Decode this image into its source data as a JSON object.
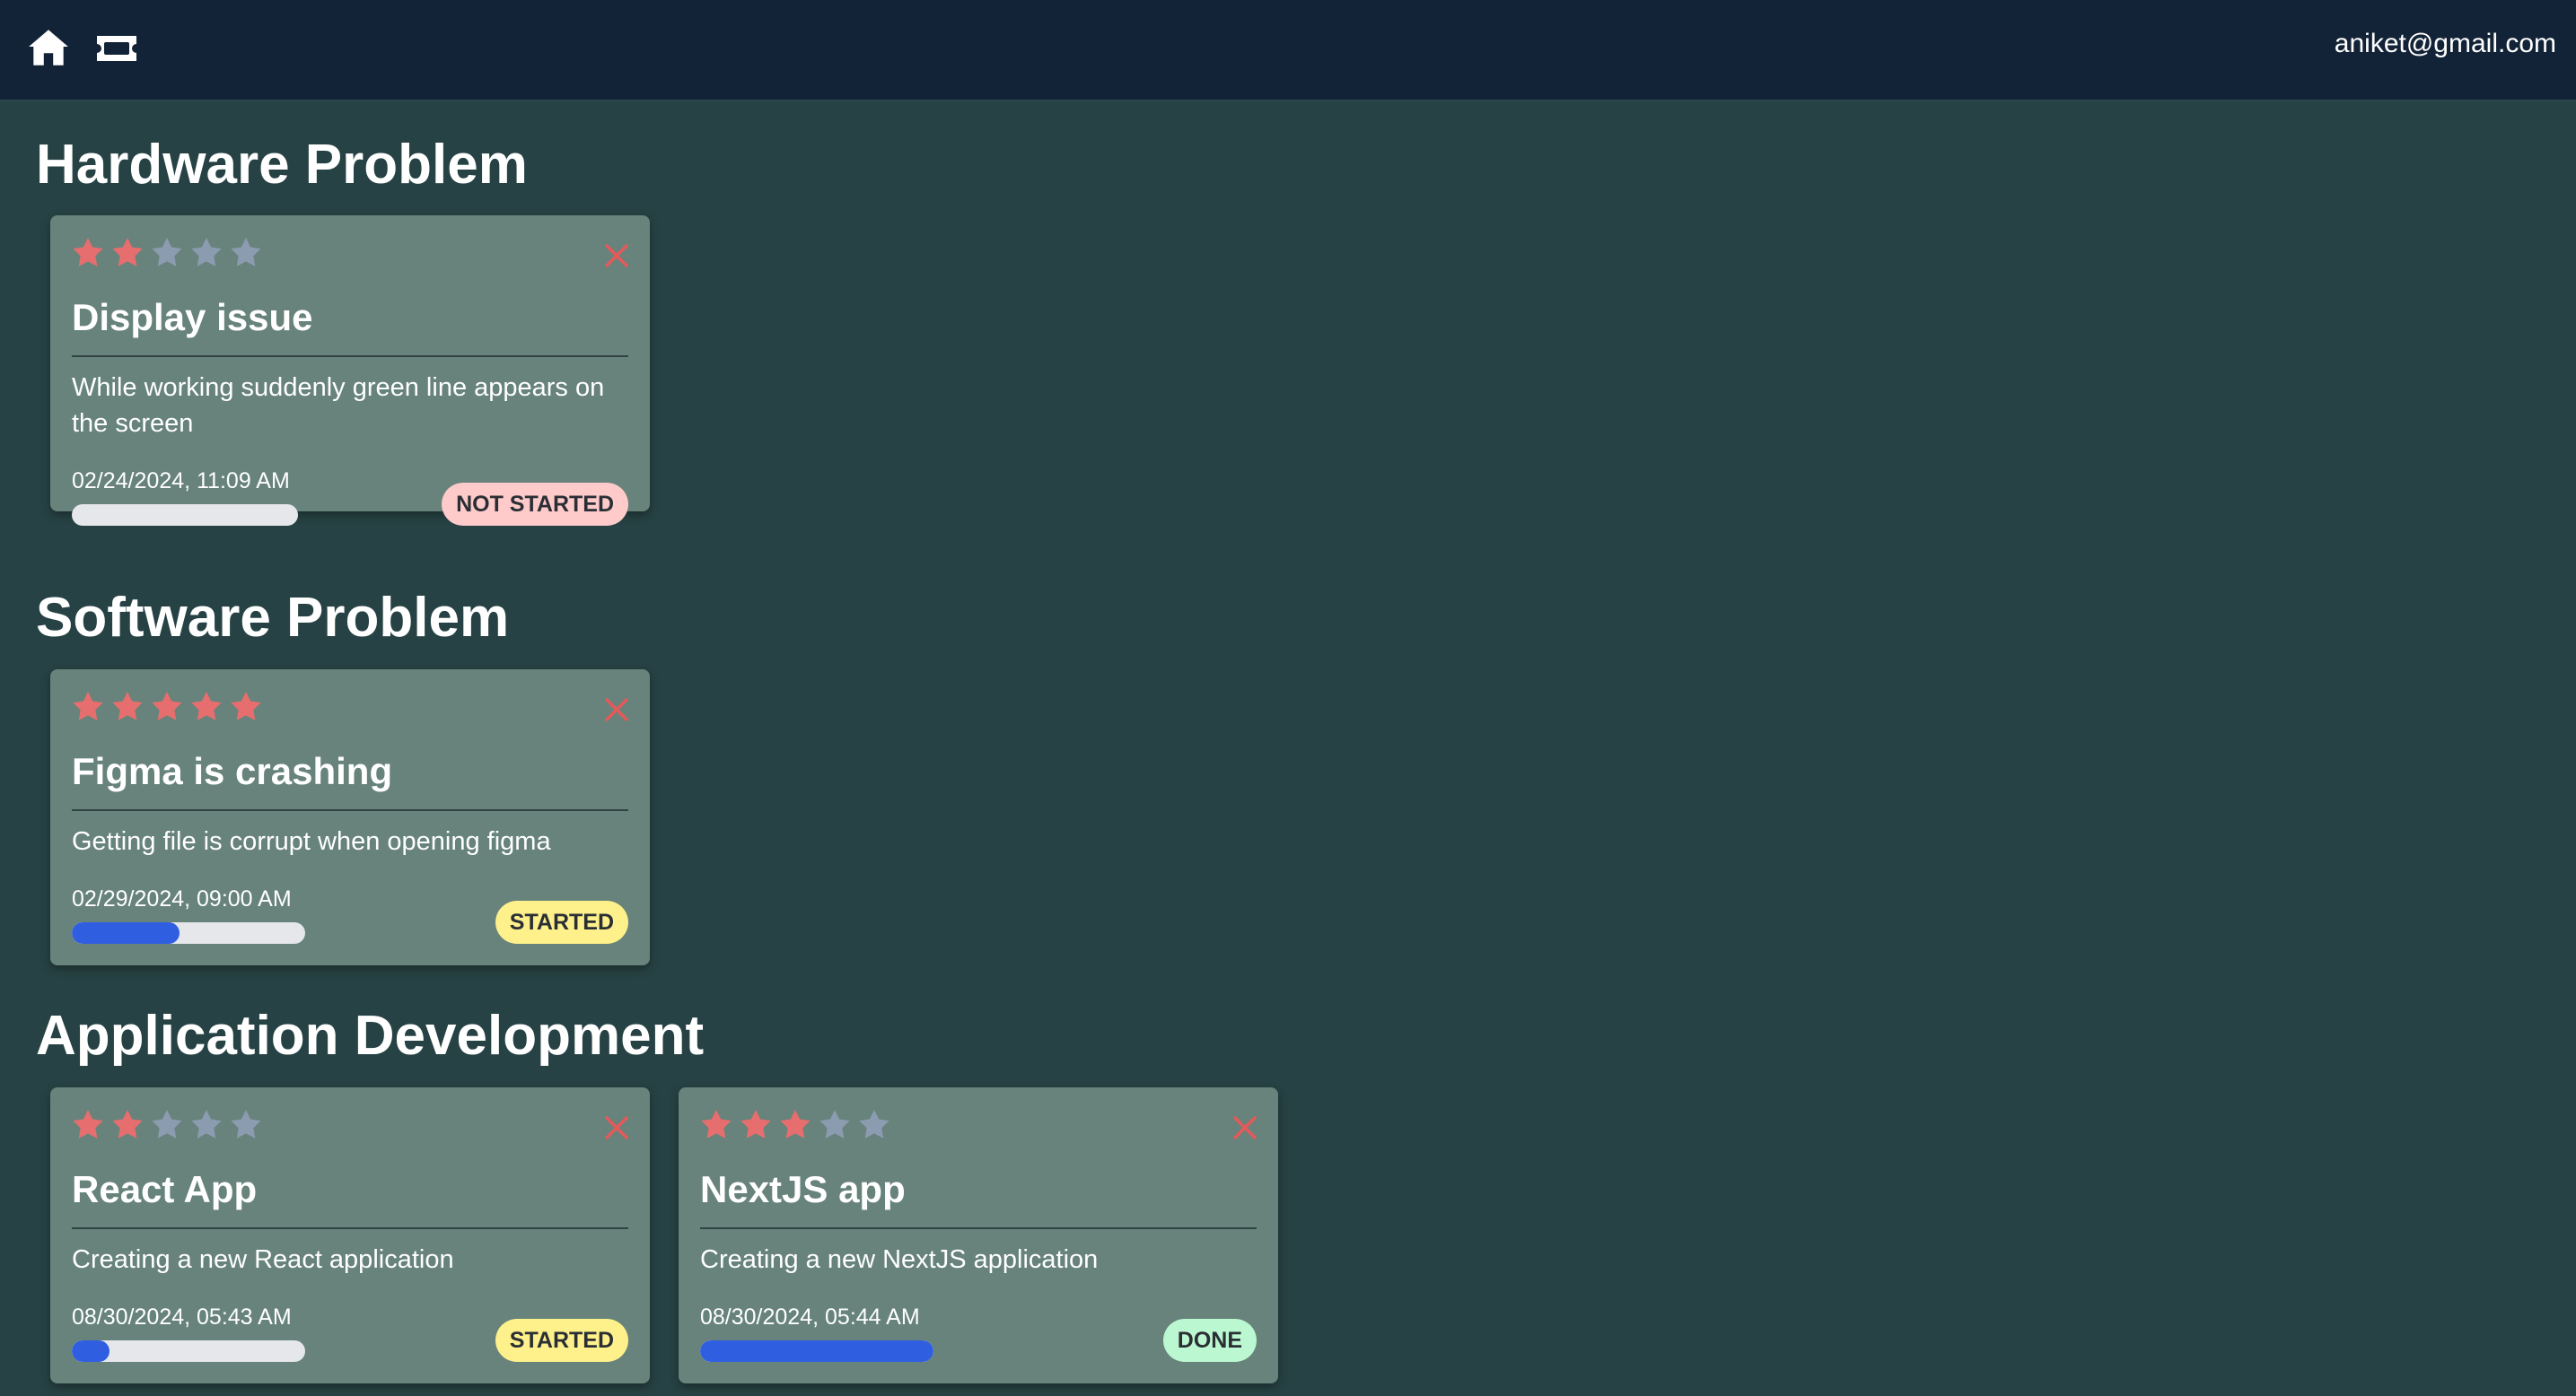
{
  "topbar": {
    "home_icon": "home-icon",
    "tickets_icon": "ticket-icon",
    "user_email": "aniket@gmail.com"
  },
  "colors": {
    "page_bg": "#274244",
    "topbar_bg": "#132337",
    "card_bg": "#67837b",
    "star_filled": "#e76e6e",
    "star_empty": "#8b9bb0",
    "progress_fill": "#2f5fe0",
    "badge_not_started": "#fecaca",
    "badge_started": "#fef08a",
    "badge_done": "#bbf7d0"
  },
  "sections": [
    {
      "title": "Hardware Problem",
      "tickets": [
        {
          "priority": 2,
          "max_priority": 5,
          "title": "Display issue",
          "description": "While working suddenly green line appears on the screen",
          "date": "02/24/2024, 11:09 AM",
          "progress": 0,
          "status": "NOT STARTED",
          "status_color": "#fecaca"
        }
      ]
    },
    {
      "title": "Software Problem",
      "tickets": [
        {
          "priority": 5,
          "max_priority": 5,
          "title": "Figma is crashing",
          "description": "Getting file is corrupt when opening figma",
          "date": "02/29/2024, 09:00 AM",
          "progress": 0.46,
          "status": "STARTED",
          "status_color": "#fef08a"
        }
      ]
    },
    {
      "title": "Application Development",
      "tickets": [
        {
          "priority": 2,
          "max_priority": 5,
          "title": "React App",
          "description": "Creating a new React application",
          "date": "08/30/2024, 05:43 AM",
          "progress": 0.16,
          "status": "STARTED",
          "status_color": "#fef08a"
        },
        {
          "priority": 3,
          "max_priority": 5,
          "title": "NextJS app",
          "description": "Creating a new NextJS application",
          "date": "08/30/2024, 05:44 AM",
          "progress": 1,
          "status": "DONE",
          "status_color": "#bbf7d0"
        }
      ]
    }
  ]
}
